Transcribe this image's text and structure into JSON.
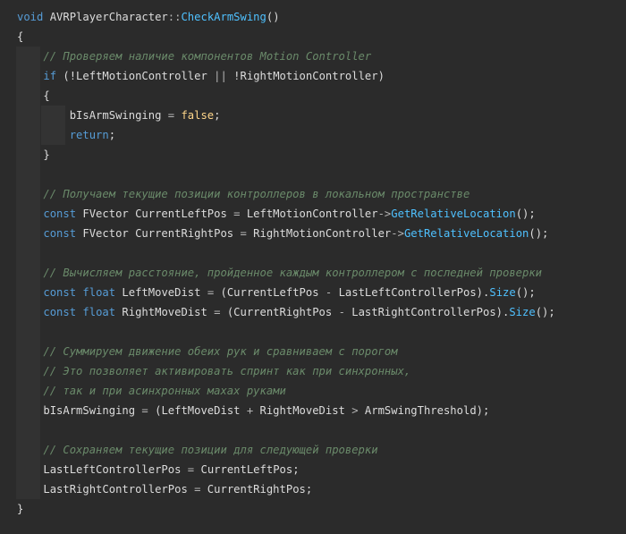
{
  "colors": {
    "background": "#2b2b2b",
    "keyword": "#569cd6",
    "function": "#4fc1ff",
    "comment": "#6a8a6a",
    "text": "#dcdcdc",
    "literal": "#ffd68a"
  },
  "lines": [
    {
      "segments": [
        {
          "c": "kw",
          "t": "void"
        },
        {
          "c": "plain",
          "t": " AVRPlayerCharacter"
        },
        {
          "c": "op",
          "t": "::"
        },
        {
          "c": "fn",
          "t": "CheckArmSwing"
        },
        {
          "c": "plain",
          "t": "()"
        }
      ]
    },
    {
      "segments": [
        {
          "c": "plain",
          "t": "{"
        }
      ]
    },
    {
      "indent": 1,
      "segments": [
        {
          "c": "cmt",
          "t": "// Проверяем наличие компонентов Motion Controller"
        }
      ]
    },
    {
      "indent": 1,
      "segments": [
        {
          "c": "kw",
          "t": "if"
        },
        {
          "c": "plain",
          "t": " (!LeftMotionController "
        },
        {
          "c": "op",
          "t": "||"
        },
        {
          "c": "plain",
          "t": " !RightMotionController)"
        }
      ]
    },
    {
      "indent": 1,
      "segments": [
        {
          "c": "plain",
          "t": "{"
        }
      ]
    },
    {
      "indent": 2,
      "segments": [
        {
          "c": "plain",
          "t": "bIsArmSwinging "
        },
        {
          "c": "op",
          "t": "="
        },
        {
          "c": "plain",
          "t": " "
        },
        {
          "c": "lit",
          "t": "false"
        },
        {
          "c": "plain",
          "t": ";"
        }
      ]
    },
    {
      "indent": 2,
      "segments": [
        {
          "c": "kw",
          "t": "return"
        },
        {
          "c": "plain",
          "t": ";"
        }
      ]
    },
    {
      "indent": 1,
      "segments": [
        {
          "c": "plain",
          "t": "}"
        }
      ]
    },
    {
      "indent": 1,
      "segments": []
    },
    {
      "indent": 1,
      "segments": [
        {
          "c": "cmt",
          "t": "// Получаем текущие позиции контроллеров в локальном пространстве"
        }
      ]
    },
    {
      "indent": 1,
      "segments": [
        {
          "c": "kw",
          "t": "const"
        },
        {
          "c": "plain",
          "t": " FVector CurrentLeftPos "
        },
        {
          "c": "op",
          "t": "="
        },
        {
          "c": "plain",
          "t": " LeftMotionController"
        },
        {
          "c": "op",
          "t": "->"
        },
        {
          "c": "fn",
          "t": "GetRelativeLocation"
        },
        {
          "c": "plain",
          "t": "();"
        }
      ]
    },
    {
      "indent": 1,
      "segments": [
        {
          "c": "kw",
          "t": "const"
        },
        {
          "c": "plain",
          "t": " FVector CurrentRightPos "
        },
        {
          "c": "op",
          "t": "="
        },
        {
          "c": "plain",
          "t": " RightMotionController"
        },
        {
          "c": "op",
          "t": "->"
        },
        {
          "c": "fn",
          "t": "GetRelativeLocation"
        },
        {
          "c": "plain",
          "t": "();"
        }
      ]
    },
    {
      "indent": 1,
      "segments": []
    },
    {
      "indent": 1,
      "segments": [
        {
          "c": "cmt",
          "t": "// Вычисляем расстояние, пройденное каждым контроллером с последней проверки"
        }
      ]
    },
    {
      "indent": 1,
      "segments": [
        {
          "c": "kw",
          "t": "const"
        },
        {
          "c": "plain",
          "t": " "
        },
        {
          "c": "kw",
          "t": "float"
        },
        {
          "c": "plain",
          "t": " LeftMoveDist "
        },
        {
          "c": "op",
          "t": "="
        },
        {
          "c": "plain",
          "t": " (CurrentLeftPos "
        },
        {
          "c": "op",
          "t": "-"
        },
        {
          "c": "plain",
          "t": " LastLeftControllerPos)."
        },
        {
          "c": "fn",
          "t": "Size"
        },
        {
          "c": "plain",
          "t": "();"
        }
      ]
    },
    {
      "indent": 1,
      "segments": [
        {
          "c": "kw",
          "t": "const"
        },
        {
          "c": "plain",
          "t": " "
        },
        {
          "c": "kw",
          "t": "float"
        },
        {
          "c": "plain",
          "t": " RightMoveDist "
        },
        {
          "c": "op",
          "t": "="
        },
        {
          "c": "plain",
          "t": " (CurrentRightPos "
        },
        {
          "c": "op",
          "t": "-"
        },
        {
          "c": "plain",
          "t": " LastRightControllerPos)."
        },
        {
          "c": "fn",
          "t": "Size"
        },
        {
          "c": "plain",
          "t": "();"
        }
      ]
    },
    {
      "indent": 1,
      "segments": []
    },
    {
      "indent": 1,
      "segments": [
        {
          "c": "cmt",
          "t": "// Суммируем движение обеих рук и сравниваем с порогом"
        }
      ]
    },
    {
      "indent": 1,
      "segments": [
        {
          "c": "cmt",
          "t": "// Это позволяет активировать спринт как при синхронных,"
        }
      ]
    },
    {
      "indent": 1,
      "segments": [
        {
          "c": "cmt",
          "t": "// так и при асинхронных махах руками"
        }
      ]
    },
    {
      "indent": 1,
      "segments": [
        {
          "c": "plain",
          "t": "bIsArmSwinging "
        },
        {
          "c": "op",
          "t": "="
        },
        {
          "c": "plain",
          "t": " (LeftMoveDist "
        },
        {
          "c": "op",
          "t": "+"
        },
        {
          "c": "plain",
          "t": " RightMoveDist "
        },
        {
          "c": "op",
          "t": ">"
        },
        {
          "c": "plain",
          "t": " ArmSwingThreshold);"
        }
      ]
    },
    {
      "indent": 1,
      "segments": []
    },
    {
      "indent": 1,
      "segments": [
        {
          "c": "cmt",
          "t": "// Сохраняем текущие позиции для следующей проверки"
        }
      ]
    },
    {
      "indent": 1,
      "segments": [
        {
          "c": "plain",
          "t": "LastLeftControllerPos "
        },
        {
          "c": "op",
          "t": "="
        },
        {
          "c": "plain",
          "t": " CurrentLeftPos;"
        }
      ]
    },
    {
      "indent": 1,
      "segments": [
        {
          "c": "plain",
          "t": "LastRightControllerPos "
        },
        {
          "c": "op",
          "t": "="
        },
        {
          "c": "plain",
          "t": " CurrentRightPos;"
        }
      ]
    },
    {
      "segments": [
        {
          "c": "plain",
          "t": "}"
        }
      ]
    }
  ]
}
